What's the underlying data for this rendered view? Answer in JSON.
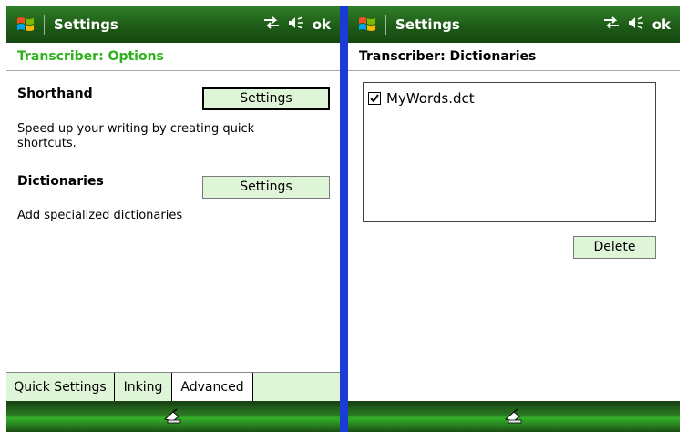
{
  "left": {
    "title": "Settings",
    "ok_label": "ok",
    "subheader": "Transcriber: Options",
    "shorthand": {
      "title": "Shorthand",
      "button": "Settings",
      "description": "Speed up your writing by creating quick shortcuts."
    },
    "dictionaries": {
      "title": "Dictionaries",
      "button": "Settings",
      "description": "Add specialized dictionaries"
    },
    "tabs": [
      {
        "label": "Quick Settings"
      },
      {
        "label": "Inking"
      },
      {
        "label": "Advanced",
        "active": true
      }
    ]
  },
  "right": {
    "title": "Settings",
    "ok_label": "ok",
    "subheader": "Transcriber: Dictionaries",
    "list_items": [
      {
        "label": "MyWords.dct",
        "checked": true
      }
    ],
    "delete_button": "Delete"
  },
  "colors": {
    "title_bar": "#1e5b17",
    "accent_green": "#2fb31c",
    "button_bg": "#dff5d8",
    "frame_blue": "#1a3bd6"
  },
  "icons": [
    "windows-start-icon",
    "connectivity-icon",
    "volume-icon",
    "keyboard-input-icon",
    "checkmark-icon"
  ]
}
